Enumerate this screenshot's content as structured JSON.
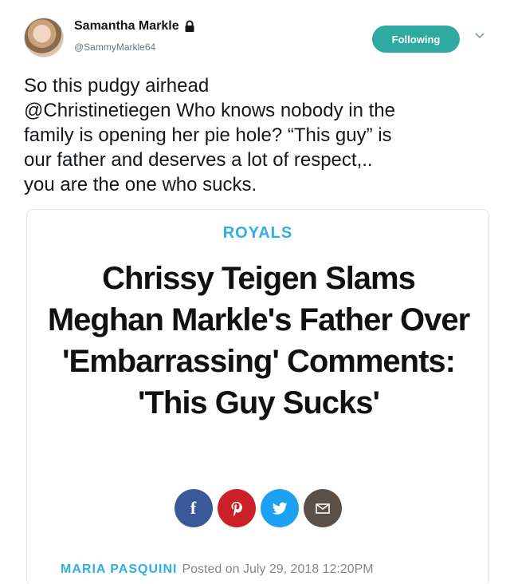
{
  "tweet": {
    "display_name": "Samantha Markle",
    "handle": "@SammyMarkle64",
    "follow_label": "Following",
    "text": "So this pudgy airhead\n@Christinetiegen  Who knows nobody in the\nfamily is opening her pie hole? “This guy”  is\nour father and deserves a lot of respect,..\nyou are the one who sucks."
  },
  "card": {
    "category": "ROYALS",
    "headline": "Chrissy Teigen Slams Meghan Markle's Father Over 'Embarrassing' Comments: 'This Guy Sucks'",
    "share_buttons": [
      {
        "icon": "facebook-icon",
        "glyph": "f",
        "color": "#3b5998"
      },
      {
        "icon": "pinterest-icon",
        "glyph": "P",
        "color": "#cb2027"
      },
      {
        "icon": "twitter-icon",
        "glyph": "t",
        "color": "#1da1f2"
      },
      {
        "icon": "email-icon",
        "glyph": "✉",
        "color": "#5a5048"
      }
    ],
    "author": "MARIA PASQUINI",
    "posted": "Posted on July 29, 2018 12:20PM"
  },
  "colors": {
    "follow_button": "#2eaaa3",
    "category": "#2fb0e0",
    "author": "#2fb0e0"
  }
}
